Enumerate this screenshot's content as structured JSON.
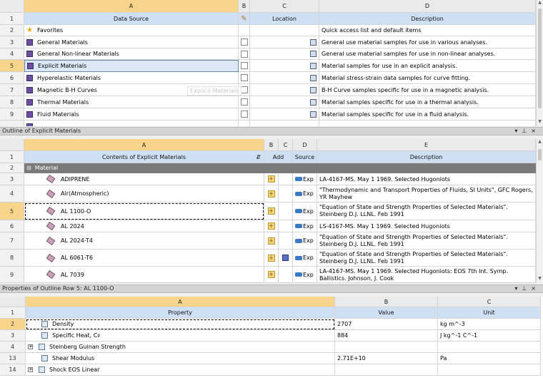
{
  "toolbox": {
    "columns": [
      "A",
      "B",
      "C",
      "D"
    ],
    "subheaders": {
      "a": "Data Source",
      "c": "Location",
      "d": "Description"
    },
    "rows": [
      {
        "num": "1"
      },
      {
        "num": "2",
        "name": "Favorites",
        "icon": "star-icon",
        "desc": "Quick access list and default items"
      },
      {
        "num": "3",
        "name": "General Materials",
        "icon": "library-icon",
        "desc": "General use material samples for use in various analyses."
      },
      {
        "num": "4",
        "name": "General Non-linear Materials",
        "icon": "library-icon",
        "desc": "General use material samples for use in non-linear analyses."
      },
      {
        "num": "5",
        "name": "Explicit Materials",
        "icon": "library-icon",
        "desc": "Material samples for use in an explicit analysis."
      },
      {
        "num": "6",
        "name": "Hyperelastic Materials",
        "icon": "library-icon",
        "desc": "Material stress-strain data samples for curve fitting."
      },
      {
        "num": "7",
        "name": "Magnetic B-H Curves",
        "icon": "library-icon",
        "desc": "B-H Curve samples specific for use in a magnetic analysis."
      },
      {
        "num": "8",
        "name": "Thermal Materials",
        "icon": "library-icon",
        "desc": "Material samples specific for use in a thermal analysis."
      },
      {
        "num": "9",
        "name": "Fluid Materials",
        "icon": "library-icon",
        "desc": "Material samples specific for use in a fluid analysis."
      }
    ],
    "drag_ghost": "Explicit Materials"
  },
  "outline": {
    "title": "Outline of Explicit Materials",
    "columns": [
      "A",
      "B",
      "C",
      "D",
      "E"
    ],
    "subheaders": {
      "a": "Contents of Explicit Materials",
      "bc": "Add",
      "d": "Source",
      "e": "Description"
    },
    "group_row": {
      "num": "2",
      "label": "Material"
    },
    "source_label": "Exp",
    "rows": [
      {
        "num": "3",
        "name": "ADIPRENE",
        "desc": "LA-4167-MS. May 1 1969. Selected Hugoniots"
      },
      {
        "num": "4",
        "name": "Air(Atmospheric)",
        "desc": "\"Thermodynamic and Transport Properties of Fluids, SI Units\", GFC Rogers, YR Mayhew"
      },
      {
        "num": "5",
        "name": "AL 1100-O",
        "desc": "\"Equation of State and Strength Properties of Selected Materials\". Steinberg D.J. LLNL. Feb 1991"
      },
      {
        "num": "6",
        "name": "AL 2024",
        "desc": "LS-4167-MS. May 1 1969. Selected Hugoniots"
      },
      {
        "num": "7",
        "name": "AL 2024-T4",
        "desc": "\"Equation of State and Strength Properties of Selected Materials\". Steinberg D.J. LLNL. Feb 1991"
      },
      {
        "num": "8",
        "name": "AL 6061-T6",
        "desc": "\"Equation of State and Strength Properties of Selected Materials\". Steinberg D.J. LLNL. Feb 1991"
      },
      {
        "num": "9",
        "name": "AL 7039",
        "desc": "LA-4167-MS. May 1 1969. Selected Hugoniots: EOS 7th Int. Symp. Ballistics. Johnson, J. Cook"
      }
    ]
  },
  "properties": {
    "title": "Properties of Outline Row 5: AL 1100-O",
    "columns": [
      "A",
      "B",
      "C"
    ],
    "subheaders": {
      "a": "Property",
      "b": "Value",
      "c": "Unit"
    },
    "rows": [
      {
        "num": "1"
      },
      {
        "num": "2",
        "name": "Density",
        "value": "2707",
        "unit": "kg m^-3"
      },
      {
        "num": "3",
        "name": "Specific Heat, C",
        "sub": "p",
        "value": "884",
        "unit": "J kg^-1 C^-1"
      },
      {
        "num": "4",
        "name": "Steinberg Guinan Strength",
        "value": "",
        "unit": ""
      },
      {
        "num": "13",
        "name": "Shear Modulus",
        "value": "2.71E+10",
        "unit": "Pa"
      },
      {
        "num": "14",
        "name": "Shock EOS Linear",
        "value": "",
        "unit": ""
      }
    ]
  }
}
